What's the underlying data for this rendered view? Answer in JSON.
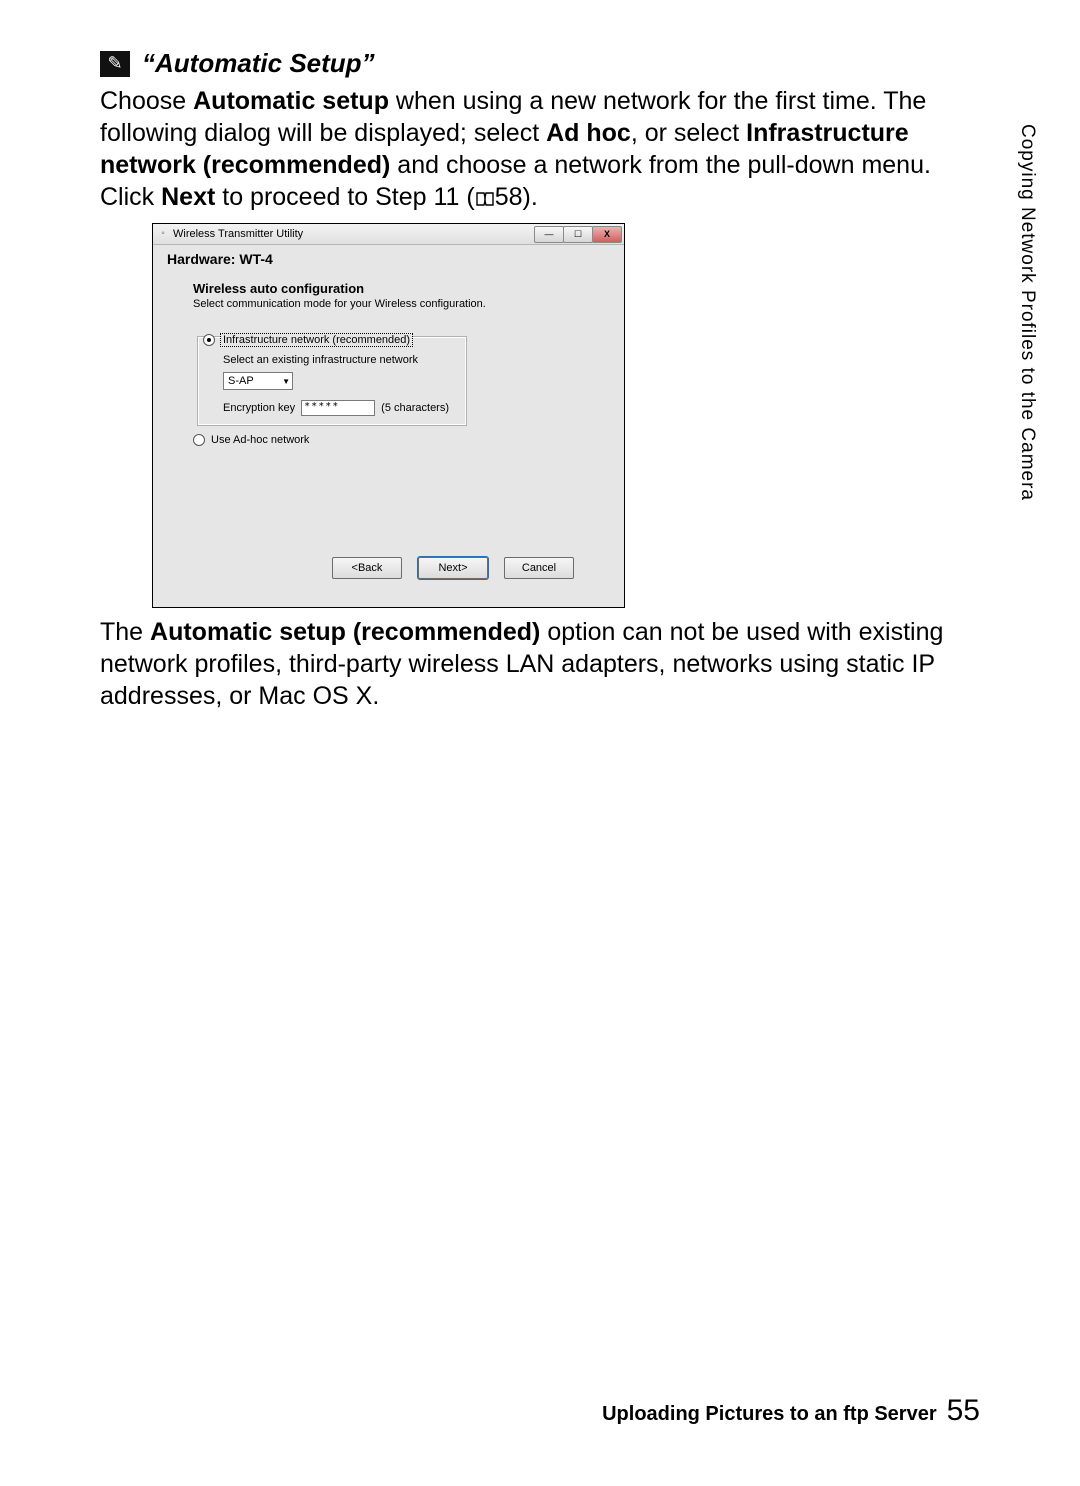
{
  "section": {
    "icon_glyph": "✎",
    "title": "“Automatic Setup”"
  },
  "para1": {
    "a": "Choose ",
    "b": "Automatic setup",
    "c": " when using a new network for the first time. The following dialog will be displayed; select ",
    "d": "Ad hoc",
    "e": ", or select ",
    "f": "Infrastructure network (recommended)",
    "g": " and choose a network from the pull-down menu. Click ",
    "h": "Next",
    "i": " to proceed to Step 11 (",
    "pgref": "58",
    "j": ")."
  },
  "dialog": {
    "app_title": "Wireless Transmitter Utility",
    "hardware_line": "Hardware: WT-4",
    "heading": "Wireless auto configuration",
    "sub": "Select communication mode for your Wireless configuration.",
    "infra_label": "Infrastructure network (recommended)",
    "infra_sub": "Select an existing infrastructure network",
    "ssid": "S-AP",
    "enc_label": "Encryption key",
    "enc_value": "*****",
    "enc_hint": "(5 characters)",
    "adhoc_label": "Use Ad-hoc network",
    "back": "<Back",
    "next": "Next>",
    "cancel": "Cancel"
  },
  "para2": {
    "a": "The ",
    "b": "Automatic setup (recommended)",
    "c": " option can not be used with existing network profiles, third-party wireless LAN adapters, networks using static IP addresses, or Mac OS X."
  },
  "side_label": "Copying Network Profiles to the Camera",
  "footer": {
    "text": "Uploading Pictures to an ftp Server",
    "page": "55"
  }
}
